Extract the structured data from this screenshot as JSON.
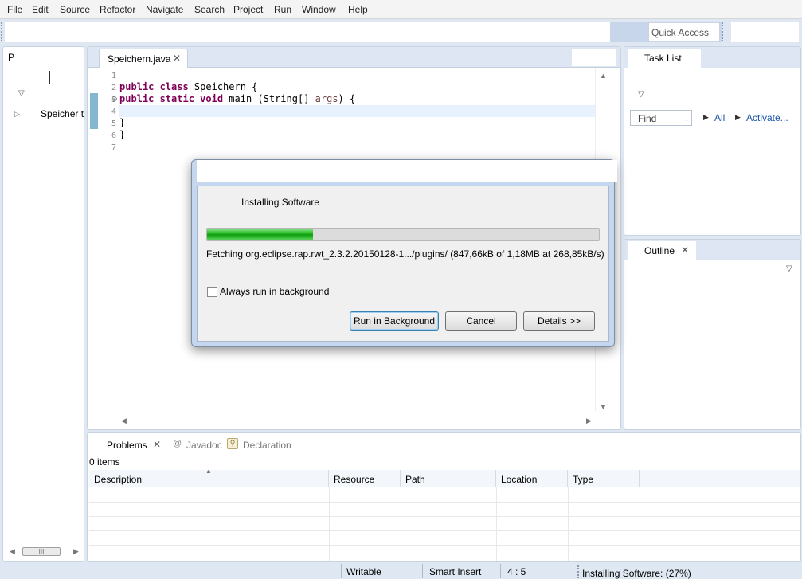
{
  "menu": [
    "File",
    "Edit",
    "Source",
    "Refactor",
    "Navigate",
    "Search",
    "Project",
    "Run",
    "Window",
    "Help"
  ],
  "toolbar": {
    "quick_access": "Quick Access"
  },
  "package_explorer": {
    "tab_label": "P",
    "tree_item": "Speicher t"
  },
  "editor": {
    "tab_label": "Speichern.java",
    "line_numbers": [
      "1",
      "2",
      "3",
      "4",
      "5",
      "6",
      "7"
    ],
    "lines": [
      {
        "kw": "",
        "rest": ""
      },
      {
        "kw": "public class",
        "rest": " Speichern {"
      },
      {
        "kw": "public static void",
        "rest": " main (String[] ",
        "var": "args",
        "tail": ") {"
      },
      {
        "kw": "",
        "rest": ""
      },
      {
        "kw": "",
        "rest": "}"
      },
      {
        "kw": "",
        "rest": "}"
      },
      {
        "kw": "",
        "rest": ""
      }
    ]
  },
  "task_list": {
    "tab_label": "Task List",
    "find_placeholder": "Find",
    "all_label": "All",
    "activate_label": "Activate..."
  },
  "outline": {
    "tab_label": "Outline"
  },
  "bottom": {
    "tabs": [
      "Problems",
      "Javadoc",
      "Declaration"
    ],
    "count": "0 items",
    "columns": [
      "Description",
      "Resource",
      "Path",
      "Location",
      "Type"
    ]
  },
  "status": {
    "writable": "Writable",
    "insert_mode": "Smart Insert",
    "position": "4 : 5",
    "task": "Installing Software: (27%)"
  },
  "dialog": {
    "heading": "Installing Software",
    "progress_fraction": 0.27,
    "detail": "Fetching org.eclipse.rap.rwt_2.3.2.20150128-1.../plugins/ (847,66kB of 1,18MB at 268,85kB/s)",
    "checkbox_label": "Always run in background",
    "buttons": {
      "background": "Run in Background",
      "cancel": "Cancel",
      "details": "Details >>"
    }
  },
  "colors": {
    "progress": "#22b622",
    "keyword": "#7f0055",
    "window_bg": "#dfe7f2"
  }
}
